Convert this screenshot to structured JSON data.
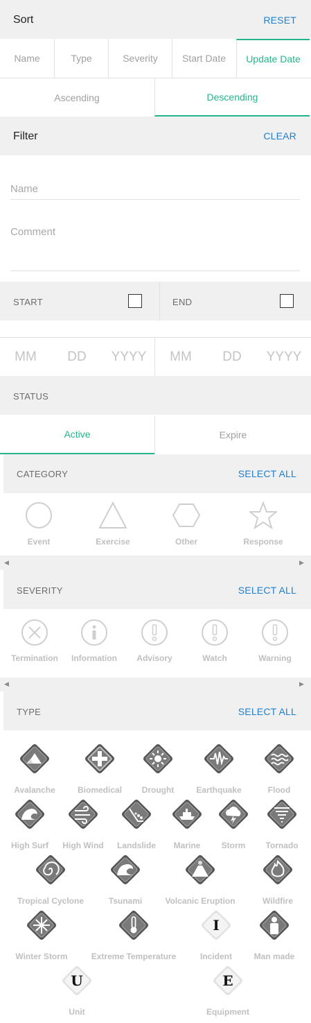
{
  "sort": {
    "title": "Sort",
    "reset": "RESET",
    "fields": [
      "Name",
      "Type",
      "Severity",
      "Start Date",
      "Update Date"
    ],
    "selected_field": "Update Date",
    "orders": [
      "Ascending",
      "Descending"
    ],
    "selected_order": "Descending"
  },
  "filter": {
    "title": "Filter",
    "clear": "CLEAR",
    "name_placeholder": "Name",
    "comment_placeholder": "Comment",
    "start_label": "START",
    "end_label": "END",
    "start_checked": false,
    "end_checked": false,
    "date_start": {
      "mm": "MM",
      "dd": "DD",
      "yyyy": "YYYY"
    },
    "date_end": {
      "mm": "MM",
      "dd": "DD",
      "yyyy": "YYYY"
    },
    "status_label": "STATUS",
    "statuses": [
      "Active",
      "Expire"
    ],
    "selected_status": "Active"
  },
  "category": {
    "title": "CATEGORY",
    "select_all": "SELECT ALL",
    "items": [
      {
        "label": "Event",
        "icon": "circle-icon"
      },
      {
        "label": "Exercise",
        "icon": "triangle-icon"
      },
      {
        "label": "Other",
        "icon": "hexagon-icon"
      },
      {
        "label": "Response",
        "icon": "star-icon"
      }
    ]
  },
  "severity": {
    "title": "SEVERITY",
    "select_all": "SELECT ALL",
    "items": [
      {
        "label": "Termination",
        "icon": "x-circle-icon"
      },
      {
        "label": "Information",
        "icon": "info-circle-icon"
      },
      {
        "label": "Advisory",
        "icon": "exclamation-circle-icon"
      },
      {
        "label": "Watch",
        "icon": "exclamation-circle-icon"
      },
      {
        "label": "Warning",
        "icon": "exclamation-circle-icon"
      }
    ]
  },
  "type": {
    "title": "TYPE",
    "select_all": "SELECT ALL",
    "items": [
      {
        "label": "Avalanche",
        "icon": "avalanche-icon"
      },
      {
        "label": "Biomedical",
        "icon": "biomedical-icon"
      },
      {
        "label": "Drought",
        "icon": "drought-icon"
      },
      {
        "label": "Earthquake",
        "icon": "earthquake-icon"
      },
      {
        "label": "Flood",
        "icon": "flood-icon"
      },
      {
        "label": "High Surf",
        "icon": "high-surf-icon"
      },
      {
        "label": "High Wind",
        "icon": "high-wind-icon"
      },
      {
        "label": "Landslide",
        "icon": "landslide-icon"
      },
      {
        "label": "Marine",
        "icon": "marine-icon"
      },
      {
        "label": "Storm",
        "icon": "storm-icon"
      },
      {
        "label": "Tornado",
        "icon": "tornado-icon"
      },
      {
        "label": "Tropical Cyclone",
        "icon": "tropical-cyclone-icon"
      },
      {
        "label": "Tsunami",
        "icon": "tsunami-icon"
      },
      {
        "label": "Volcanic Eruption",
        "icon": "volcanic-eruption-icon"
      },
      {
        "label": "Wildfire",
        "icon": "wildfire-icon"
      },
      {
        "label": "Winter Storm",
        "icon": "winter-storm-icon"
      },
      {
        "label": "Extreme Temperature",
        "icon": "thermometer-icon"
      },
      {
        "label": "Incident",
        "icon": "incident-icon",
        "letter": "I"
      },
      {
        "label": "Man made",
        "icon": "man-made-icon"
      },
      {
        "label": "Unit",
        "icon": "unit-icon",
        "letter": "U"
      },
      {
        "label": "Equipment",
        "icon": "equipment-icon",
        "letter": "E"
      }
    ]
  },
  "colors": {
    "accent": "#25b58a",
    "link": "#1f7fcf",
    "header_bg": "#f0f0f0",
    "icon_dark": "#4a4a4a",
    "icon_light": "#e0e0e0"
  }
}
